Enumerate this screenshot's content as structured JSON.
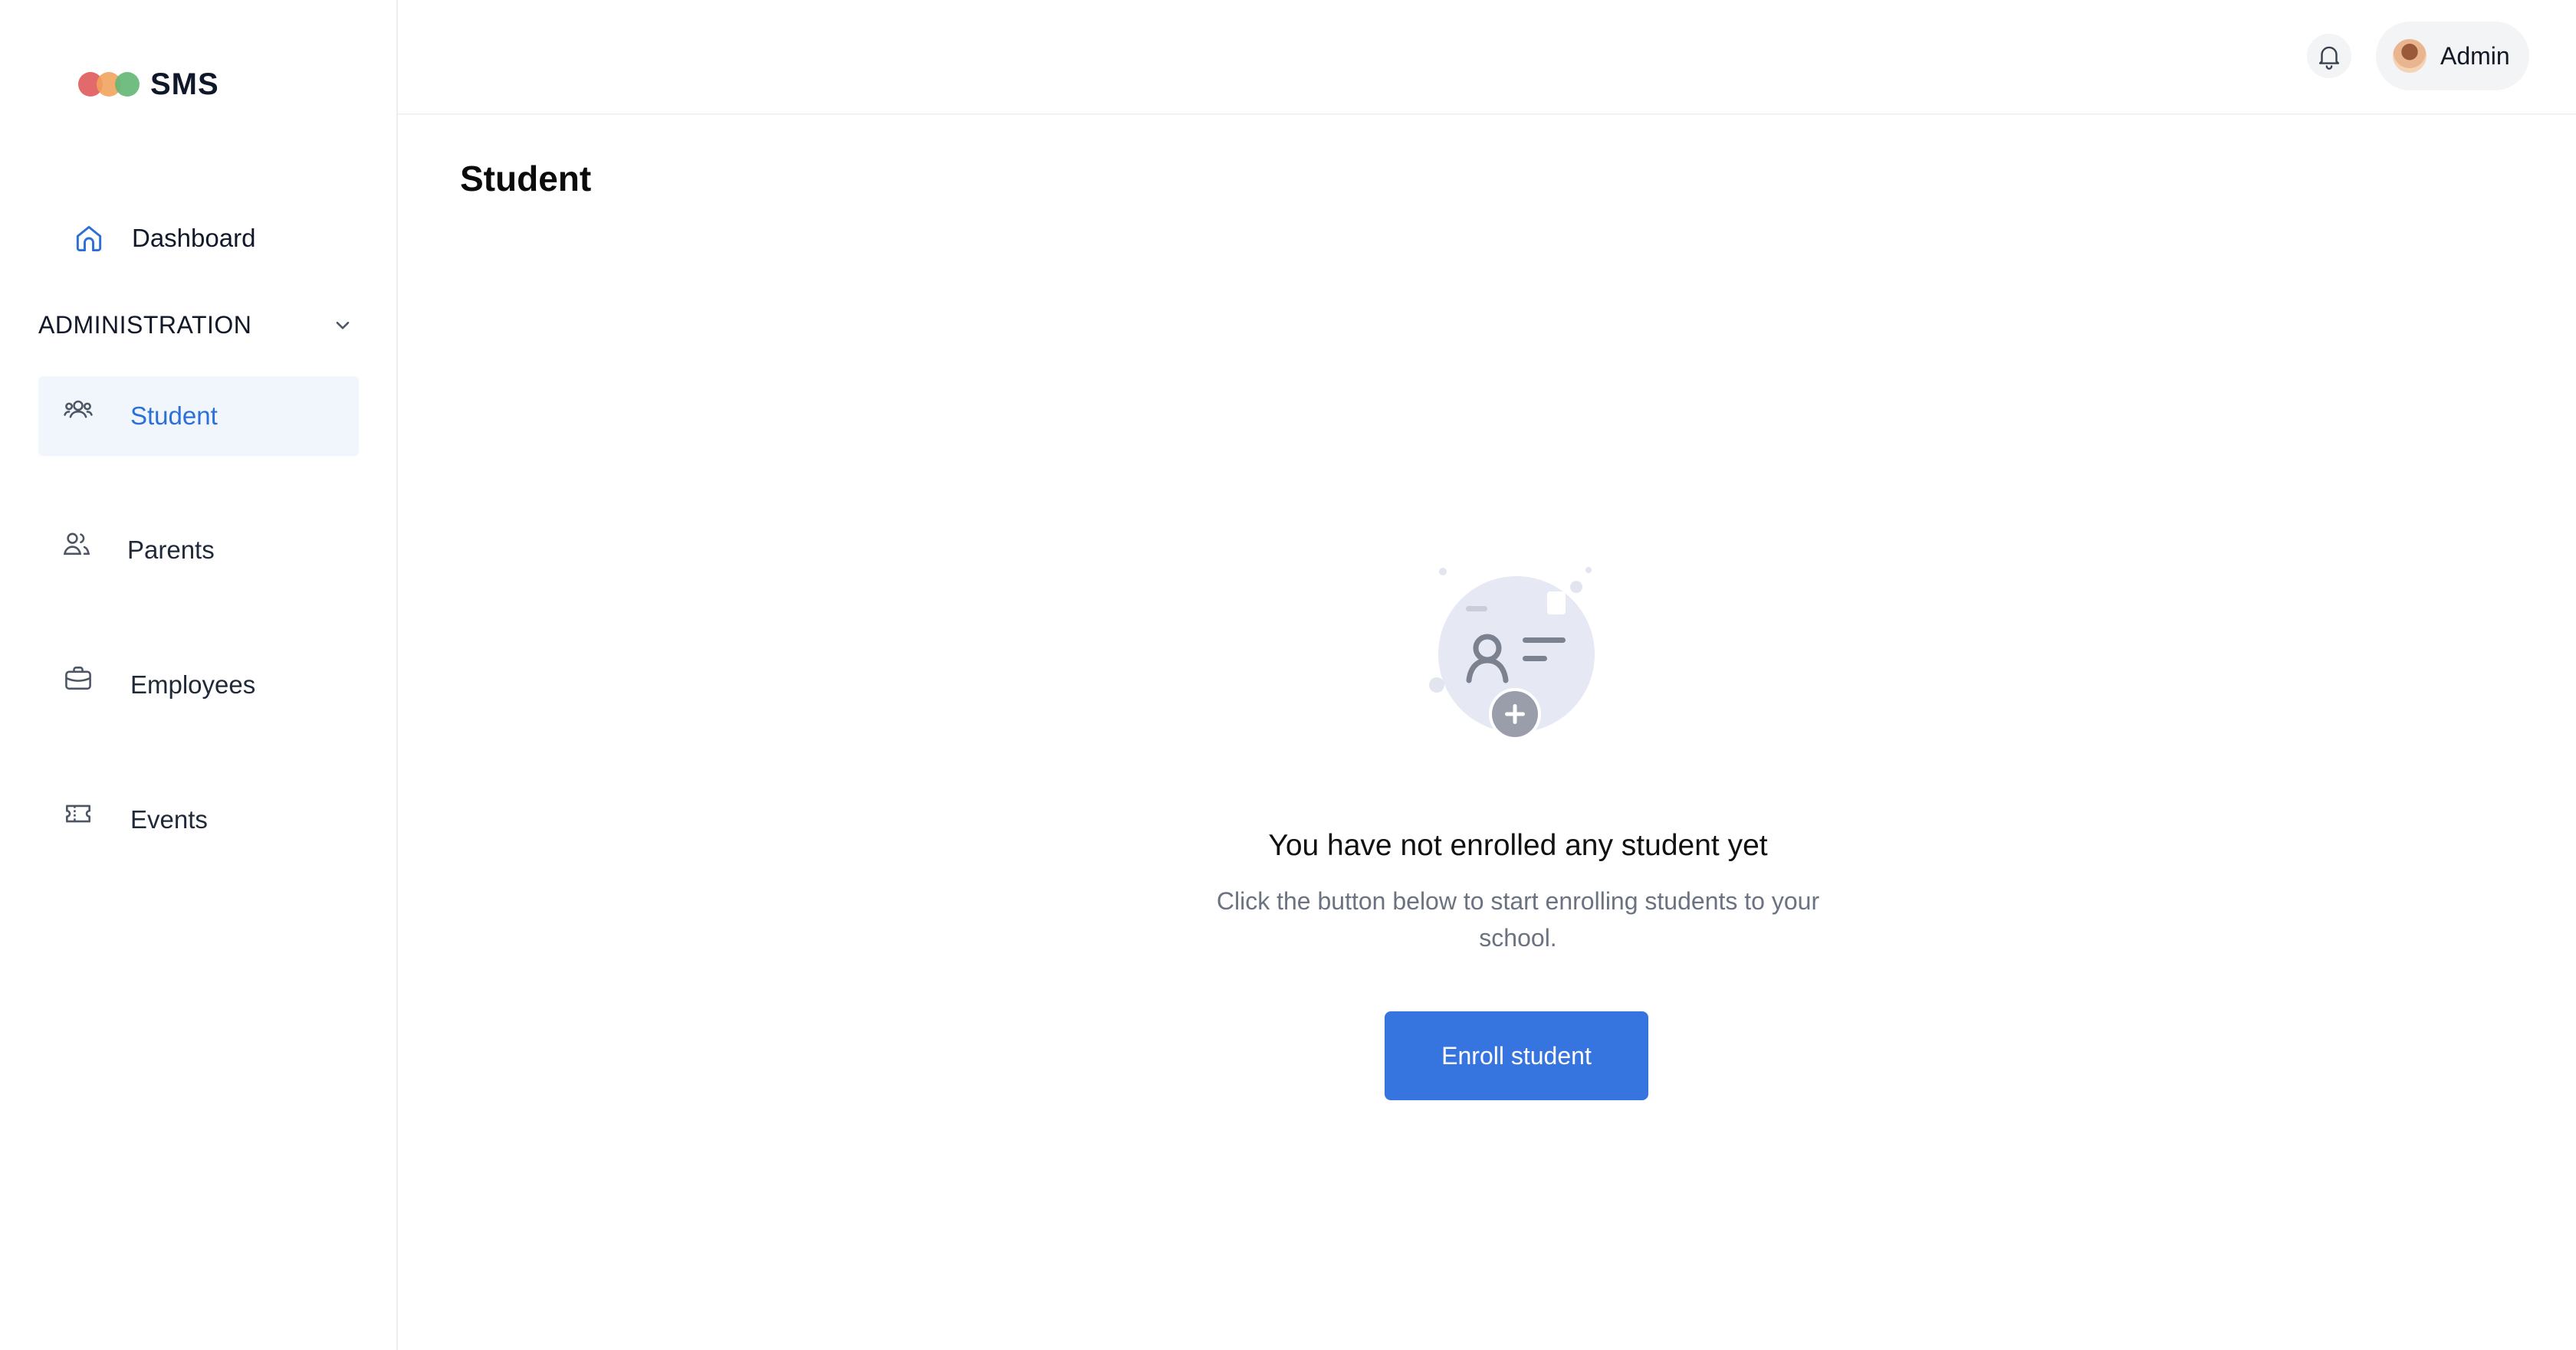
{
  "sidebar": {
    "logo_text": "SMS",
    "dashboard_label": "Dashboard",
    "section_label": "ADMINISTRATION",
    "items": [
      {
        "label": "Student",
        "icon": "users-icon",
        "active": true
      },
      {
        "label": "Parents",
        "icon": "parents-icon",
        "active": false
      },
      {
        "label": "Employees",
        "icon": "briefcase-icon",
        "active": false
      },
      {
        "label": "Events",
        "icon": "ticket-icon",
        "active": false
      }
    ]
  },
  "header": {
    "user_name": "Admin"
  },
  "main": {
    "page_title": "Student",
    "empty_title": "You have not enrolled any student yet",
    "empty_desc": "Click the button below to start enrolling students to your school.",
    "button_label": "Enroll student"
  },
  "colors": {
    "accent": "#3674e0",
    "active_bg": "#f1f6fd",
    "active_text": "#2b6fd8",
    "logo_red": "#e05a5a",
    "logo_orange": "#f0a35e",
    "logo_green": "#63b774"
  }
}
